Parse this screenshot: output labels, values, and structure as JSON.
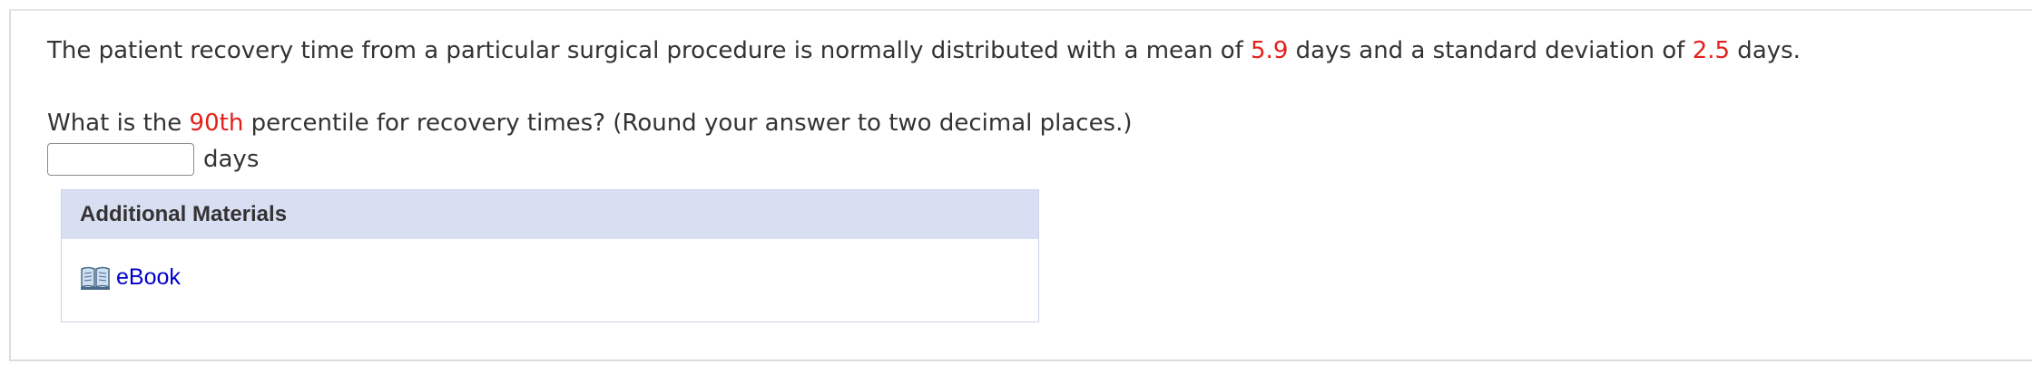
{
  "question": {
    "line1": {
      "before_mean": "The patient recovery time from a particular surgical procedure is normally distributed with a mean of ",
      "mean": "5.9",
      "between": " days and a standard deviation of ",
      "sd": "2.5",
      "after": " days."
    },
    "line2": {
      "before_pct": "What is the ",
      "percentile": "90th",
      "after": " percentile for recovery times? (Round your answer to two decimal places.)"
    }
  },
  "answer": {
    "value": "",
    "placeholder": "",
    "unit": "days"
  },
  "additional_materials": {
    "title": "Additional Materials",
    "links": [
      {
        "label": "eBook",
        "icon": "book-icon"
      }
    ]
  },
  "colors": {
    "highlight": "#e3201b",
    "link": "#0000cc",
    "header_bg": "#d9dff3",
    "text": "#333333"
  }
}
